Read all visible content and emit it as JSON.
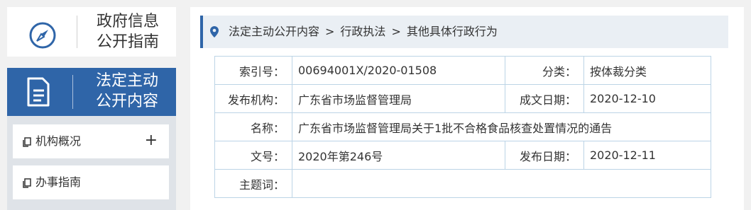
{
  "sidebar": {
    "guide_title_line1": "政府信息",
    "guide_title_line2": "公开指南",
    "active_title_line1": "法定主动",
    "active_title_line2": "公开内容",
    "menu": [
      {
        "label": "机构概况",
        "expand": "+"
      },
      {
        "label": "办事指南"
      }
    ]
  },
  "breadcrumb": {
    "items": [
      "法定主动公开内容",
      "行政执法",
      "其他具体行政行为"
    ],
    "separator": ">"
  },
  "info": {
    "index_label": "索引号：",
    "index_value": "00694001X/2020-01508",
    "category_label": "分类：",
    "category_value": "按体裁分类",
    "publisher_label": "发布机构：",
    "publisher_value": "广东省市场监督管理局",
    "created_label": "成文日期：",
    "created_value": "2020-12-10",
    "name_label": "名称：",
    "name_value": "广东省市场监督管理局关于1批不合格食品核查处置情况的通告",
    "docno_label": "文号：",
    "docno_value": "2020年第246号",
    "published_label": "发布日期：",
    "published_value": "2020-12-11",
    "subject_label": "主题词：",
    "subject_value": ""
  },
  "colors": {
    "accent": "#2f65a8",
    "page_bg": "#f1f1f1",
    "breadcrumb_bg": "#eaeff4",
    "table_border": "#bcd4e6"
  },
  "icons": [
    "compass-icon",
    "document-icon",
    "copy-icon",
    "map-pin-icon"
  ]
}
